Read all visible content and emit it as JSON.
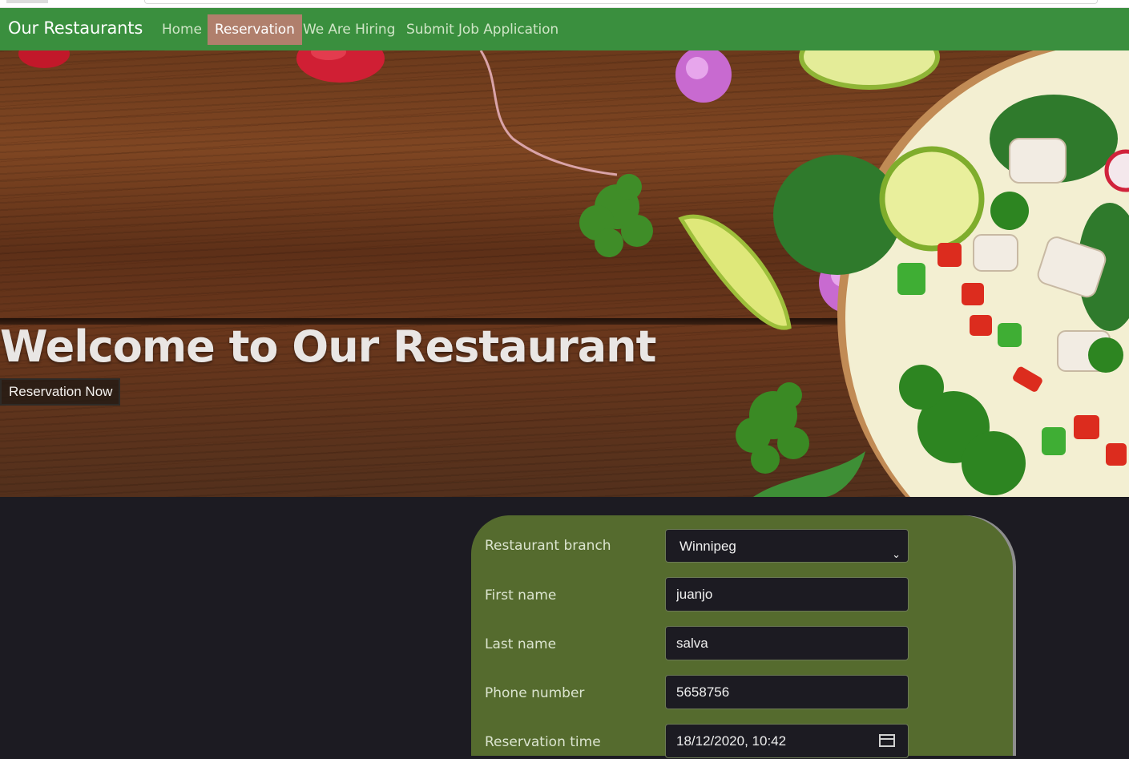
{
  "navbar": {
    "brand": "Our Restaurants",
    "links": [
      {
        "label": "Home",
        "active": false
      },
      {
        "label": "Reservation",
        "active": true
      },
      {
        "label": "We Are Hiring",
        "active": false
      },
      {
        "label": "Submit Job Application",
        "active": false
      }
    ]
  },
  "hero": {
    "title": "Welcome to Our Restaurant",
    "button_label": "Reservation Now"
  },
  "form": {
    "branch": {
      "label": "Restaurant branch",
      "value": "Winnipeg"
    },
    "first_name": {
      "label": "First name",
      "value": "juanjo"
    },
    "last_name": {
      "label": "Last name",
      "value": "salva"
    },
    "phone": {
      "label": "Phone number",
      "value": "5658756"
    },
    "time": {
      "label": "Reservation time",
      "value": "18/12/2020, 10:42"
    }
  },
  "colors": {
    "navbar_bg": "#3a8f3e",
    "active_link_bg": "#b07f6c",
    "form_card_bg": "#556b2e",
    "page_bg": "#1c1b22"
  }
}
